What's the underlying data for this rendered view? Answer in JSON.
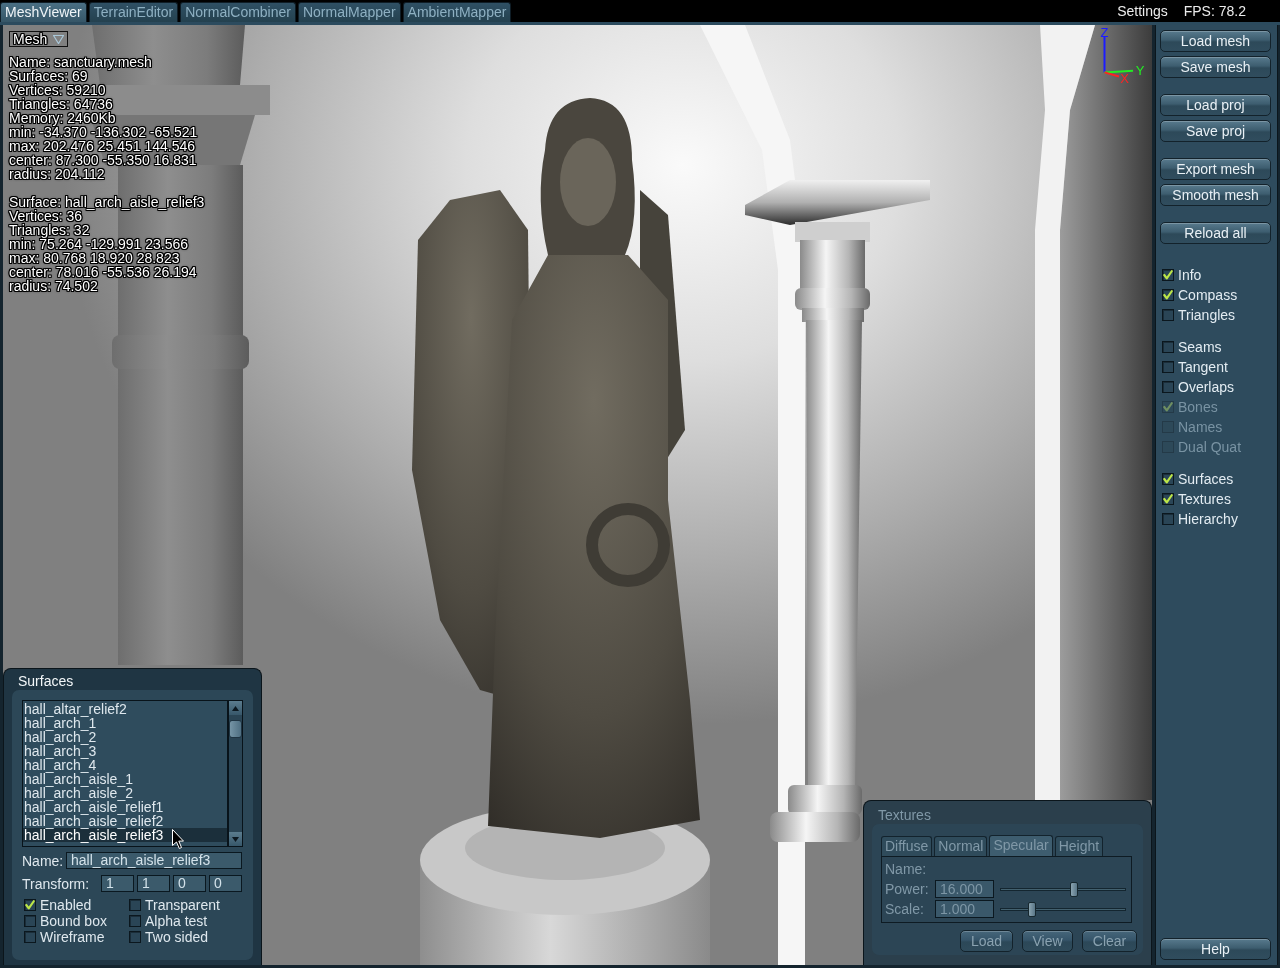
{
  "top_bar": {
    "tabs": [
      {
        "label": "MeshViewer",
        "selected": true
      },
      {
        "label": "TerrainEditor",
        "selected": false
      },
      {
        "label": "NormalCombiner",
        "selected": false
      },
      {
        "label": "NormalMapper",
        "selected": false
      },
      {
        "label": "AmbientMapper",
        "selected": false
      }
    ],
    "settings": "Settings",
    "fps": "FPS: 78.2"
  },
  "viewport": {
    "mesh_menu": "Mesh",
    "mesh_info": [
      "Name: sanctuary.mesh",
      "Surfaces: 69",
      "Vertices: 59210",
      "Triangles: 64736",
      "Memory: 2460Kb",
      "min: -34.370 -136.302 -65.521",
      "max: 202.476 25.451 144.546",
      "center: 87.300 -55.350 16.831",
      "radius: 204.112"
    ],
    "surface_info": [
      "Surface: hall_arch_aisle_relief3",
      "Vertices: 36",
      "Triangles: 32",
      "min: 75.264 -129.991 23.566",
      "max: 80.768 18.920 28.823",
      "center: 78.016 -55.536 26.194",
      "radius: 74.502"
    ],
    "compass": [
      {
        "label": "Z",
        "color": "#1c1cff"
      },
      {
        "label": "Y",
        "color": "#22ee22"
      },
      {
        "label": "X",
        "color": "#ff2222"
      }
    ]
  },
  "surfaces_panel": {
    "title": "Surfaces",
    "items": [
      {
        "label": "hall_altar_relief2",
        "selected": false
      },
      {
        "label": "hall_arch_1",
        "selected": false
      },
      {
        "label": "hall_arch_2",
        "selected": false
      },
      {
        "label": "hall_arch_3",
        "selected": false
      },
      {
        "label": "hall_arch_4",
        "selected": false
      },
      {
        "label": "hall_arch_aisle_1",
        "selected": false
      },
      {
        "label": "hall_arch_aisle_2",
        "selected": false
      },
      {
        "label": "hall_arch_aisle_relief1",
        "selected": false
      },
      {
        "label": "hall_arch_aisle_relief2",
        "selected": false
      },
      {
        "label": "hall_arch_aisle_relief3",
        "selected": true
      }
    ],
    "name_label": "Name:",
    "name_value": "hall_arch_aisle_relief3",
    "transform_label": "Transform:",
    "transform_values": [
      "1",
      "1",
      "0",
      "0"
    ],
    "options": [
      {
        "label": "Enabled",
        "checked": true
      },
      {
        "label": "Transparent",
        "checked": false
      },
      {
        "label": "Bound box",
        "checked": false
      },
      {
        "label": "Alpha test",
        "checked": false
      },
      {
        "label": "Wireframe",
        "checked": false
      },
      {
        "label": "Two sided",
        "checked": false
      }
    ]
  },
  "textures_panel": {
    "title": "Textures",
    "disabled": true,
    "tabs": [
      {
        "label": "Diffuse",
        "selected": false
      },
      {
        "label": "Normal",
        "selected": false
      },
      {
        "label": "Specular",
        "selected": true
      },
      {
        "label": "Height",
        "selected": false
      }
    ],
    "name_label": "Name:",
    "fields": [
      {
        "label": "Power:",
        "value": "16.000",
        "level": 0.59
      },
      {
        "label": "Scale:",
        "value": "1.000",
        "level": 0.24
      }
    ],
    "buttons": [
      "Load",
      "View",
      "Clear"
    ]
  },
  "sidebar": {
    "button_groups": [
      [
        "Load mesh",
        "Save mesh"
      ],
      [
        "Load proj",
        "Save proj"
      ],
      [
        "Export mesh",
        "Smooth mesh"
      ],
      [
        "Reload all"
      ]
    ],
    "checkbox_groups": [
      [
        {
          "label": "Info",
          "checked": true,
          "disabled": false
        },
        {
          "label": "Compass",
          "checked": true,
          "disabled": false
        },
        {
          "label": "Triangles",
          "checked": false,
          "disabled": false
        }
      ],
      [
        {
          "label": "Seams",
          "checked": false,
          "disabled": false
        },
        {
          "label": "Tangent",
          "checked": false,
          "disabled": false
        },
        {
          "label": "Overlaps",
          "checked": false,
          "disabled": false
        },
        {
          "label": "Bones",
          "checked": true,
          "disabled": true
        },
        {
          "label": "Names",
          "checked": false,
          "disabled": true
        },
        {
          "label": "Dual Quat",
          "checked": false,
          "disabled": true
        }
      ],
      [
        {
          "label": "Surfaces",
          "checked": true,
          "disabled": false
        },
        {
          "label": "Textures",
          "checked": true,
          "disabled": false
        },
        {
          "label": "Hierarchy",
          "checked": false,
          "disabled": false
        }
      ]
    ],
    "help": "Help"
  }
}
